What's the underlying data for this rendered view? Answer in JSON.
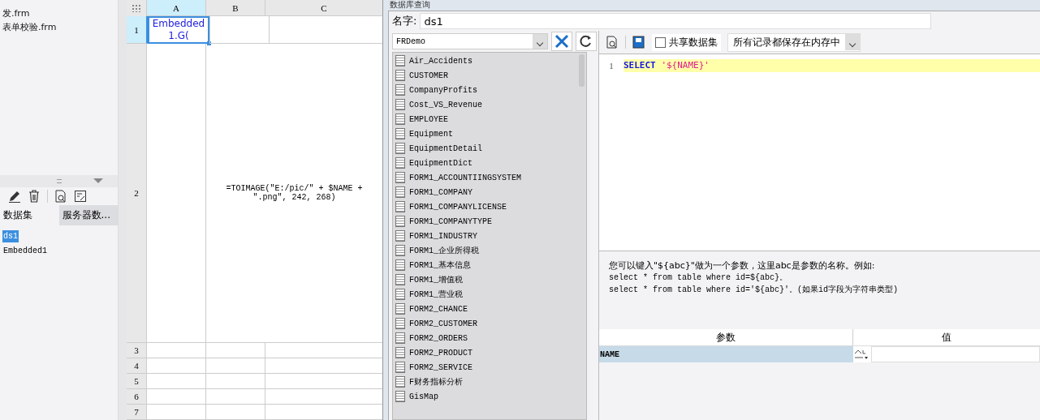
{
  "files": [
    {
      "label": "发.frm"
    },
    {
      "label": "表单校验.frm"
    }
  ],
  "dataset_tabs": [
    {
      "label": "数据集",
      "selected": true
    },
    {
      "label": "服务器数...",
      "selected": false
    }
  ],
  "datasets": [
    {
      "label": "ds1",
      "selected": true
    },
    {
      "label": "Embedded1",
      "selected": false
    }
  ],
  "sheet": {
    "columns": [
      {
        "label": "A",
        "selected": true
      },
      {
        "label": "B",
        "selected": false
      },
      {
        "label": "C",
        "selected": false
      }
    ],
    "rows": [
      {
        "number": "1",
        "selected": true,
        "kind": "cells",
        "cells": [
          "Embedded1.G(",
          "",
          ""
        ]
      },
      {
        "number": "2",
        "selected": false,
        "kind": "merged",
        "cells": [
          "",
          "=TOIMAGE(\"E:/pic/\" + $NAME + \".png\", 242, 268)"
        ]
      },
      {
        "number": "3",
        "selected": false,
        "kind": "cells",
        "cells": [
          "",
          "",
          ""
        ]
      },
      {
        "number": "4",
        "selected": false,
        "kind": "cells",
        "cells": [
          "",
          "",
          ""
        ]
      },
      {
        "number": "5",
        "selected": false,
        "kind": "cells",
        "cells": [
          "",
          "",
          ""
        ]
      },
      {
        "number": "6",
        "selected": false,
        "kind": "cells",
        "cells": [
          "",
          "",
          ""
        ]
      },
      {
        "number": "7",
        "selected": false,
        "kind": "cells",
        "cells": [
          "",
          "",
          ""
        ]
      }
    ]
  },
  "dialog": {
    "title": "数据库查询",
    "name_label": "名字:",
    "name_value": "ds1",
    "connection": "FRDemo",
    "tables": [
      "Air_Accidents",
      "CUSTOMER",
      "CompanyProfits",
      "Cost_VS_Revenue",
      "EMPLOYEE",
      "Equipment",
      "EquipmentDetail",
      "EquipmentDict",
      "FORM1_ACCOUNTIINGSYSTEM",
      "FORM1_COMPANY",
      "FORM1_COMPANYLICENSE",
      "FORM1_COMPANYTYPE",
      "FORM1_INDUSTRY",
      "FORM1_企业所得税",
      "FORM1_基本信息",
      "FORM1_增值税",
      "FORM1_营业税",
      "FORM2_CHANCE",
      "FORM2_CUSTOMER",
      "FORM2_ORDERS",
      "FORM2_PRODUCT",
      "FORM2_SERVICE",
      "F财务指标分析",
      "GisMap"
    ],
    "share": {
      "label": "共享数据集",
      "checked": false
    },
    "storage": "所有记录都保存在内存中",
    "sql_lines": [
      {
        "number": "1",
        "keyword": "SELECT",
        "string": "'${NAME}'"
      }
    ],
    "hint_lines": [
      "您可以键入\"${abc}\"做为一个参数，这里abc是参数的名称。例如:",
      "select * from table where id=${abc}。",
      "select * from table where id='${abc}'。(如果id字段为字符串类型)"
    ],
    "params": {
      "columns": [
        "参数",
        "值"
      ],
      "rows": [
        {
          "name": "NAME",
          "value": "",
          "selected": true
        }
      ]
    }
  }
}
